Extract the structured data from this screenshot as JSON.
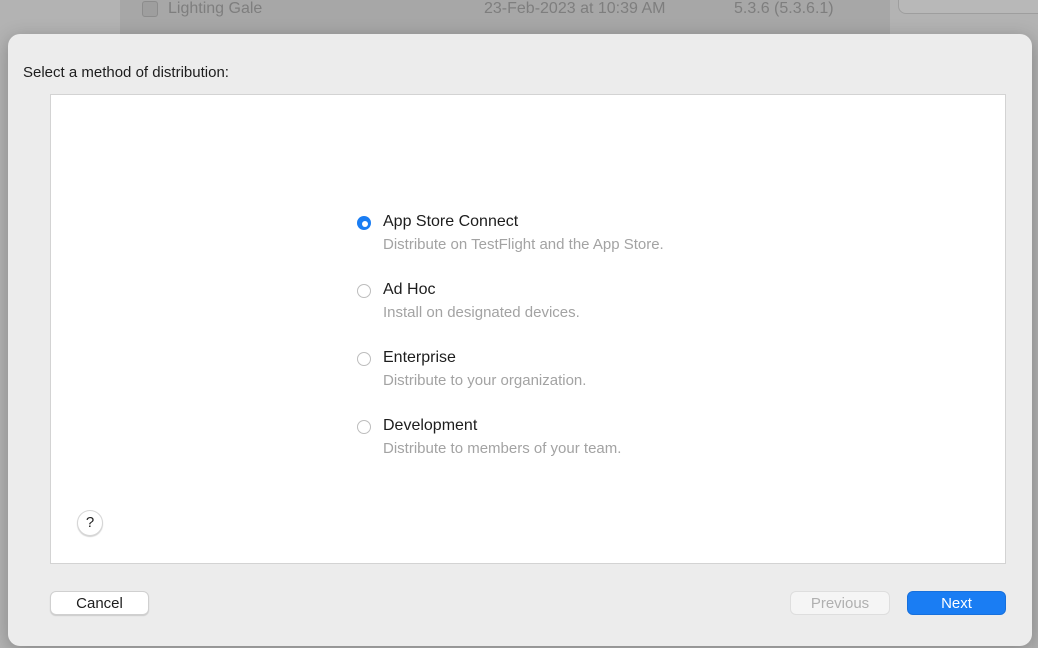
{
  "background": {
    "archive_row": {
      "name": "Lighting Gale",
      "date": "23-Feb-2023 at 10:39 AM",
      "version": "5.3.6 (5.3.6.1)"
    }
  },
  "sheet": {
    "title": "Select a method of distribution:",
    "selected_method": "App Store Connect",
    "options": [
      {
        "label": "App Store Connect",
        "description": "Distribute on TestFlight and the App Store.",
        "checked": true
      },
      {
        "label": "Ad Hoc",
        "description": "Install on designated devices.",
        "checked": false
      },
      {
        "label": "Enterprise",
        "description": "Distribute to your organization.",
        "checked": false
      },
      {
        "label": "Development",
        "description": "Distribute to members of your team.",
        "checked": false
      }
    ],
    "help_label": "?",
    "buttons": {
      "cancel": "Cancel",
      "previous": "Previous",
      "next": "Next"
    }
  },
  "icons": {
    "archive_icon": "archive-icon",
    "help_icon": "question-mark-icon"
  },
  "colors": {
    "accent": "#1a7df3",
    "sheet_background": "#ececec",
    "panel_background": "#ffffff",
    "secondary_text": "#a3a3a3",
    "disabled_text": "#b0b0b0"
  }
}
